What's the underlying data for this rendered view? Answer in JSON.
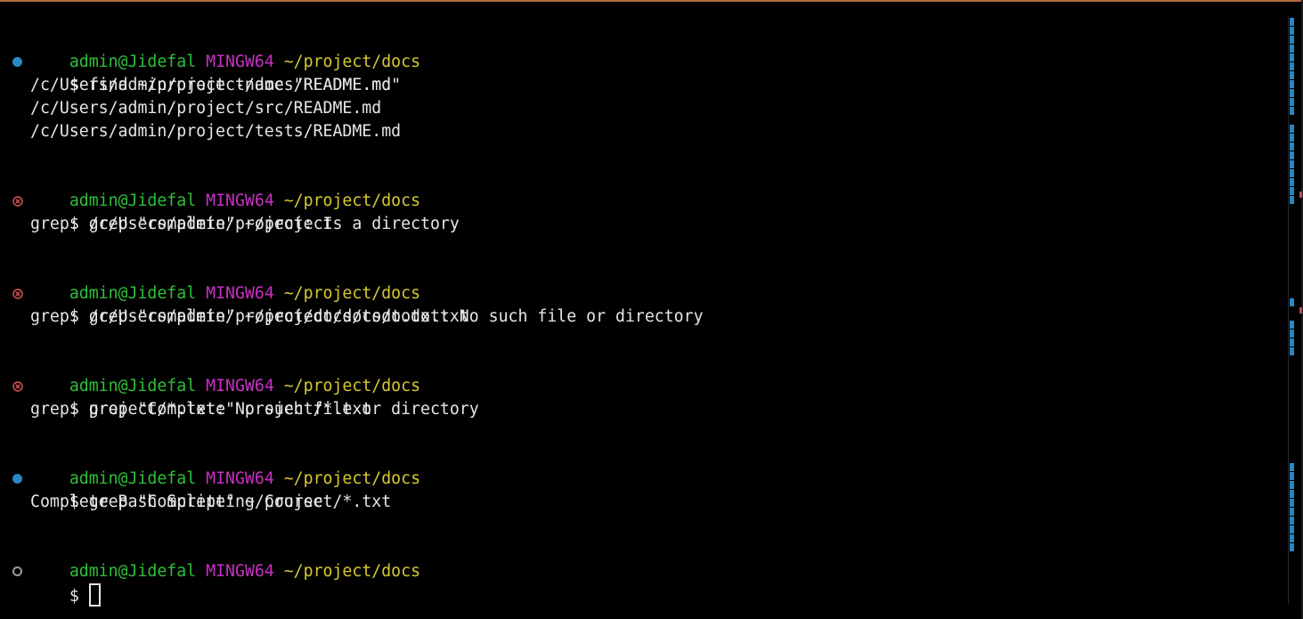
{
  "prompt": {
    "user": "admin@Jidefal",
    "host": "MINGW64",
    "path": "~/project/docs",
    "symbol": "$"
  },
  "colors": {
    "user": "#2fbf3a",
    "host": "#c930c4",
    "path": "#d7c930",
    "text": "#e6e6e6",
    "success_marker": "#2a86c4",
    "error_marker": "#e05555",
    "pending_marker": "#9a9a9a"
  },
  "blocks": [
    {
      "status": "success",
      "command": "find ~/project -name \"README.md\"",
      "output": [
        "/c/Users/admin/project/docs/README.md",
        "/c/Users/admin/project/src/README.md",
        "/c/Users/admin/project/tests/README.md"
      ]
    },
    {
      "status": "error",
      "command": "grep \"complete\" ~/project",
      "output": [
        "grep: /c/Users/admin/project: Is a directory"
      ]
    },
    {
      "status": "error",
      "command": "grep \"complete\" ~/project/docs/todo.txt",
      "output": [
        "grep: /c/Users/admin/project/docs/todo.txt: No such file or directory"
      ]
    },
    {
      "status": "error",
      "command": "grep \"Complete\" project/*.txt",
      "output": [
        "grep: project/*.txt: No such file or directory"
      ]
    },
    {
      "status": "success",
      "command": "grep \"Complete\" ~/project/*.txt",
      "output": [
        "Complete Bash Scripting Course"
      ]
    }
  ],
  "current": {
    "status": "pending",
    "command": ""
  }
}
